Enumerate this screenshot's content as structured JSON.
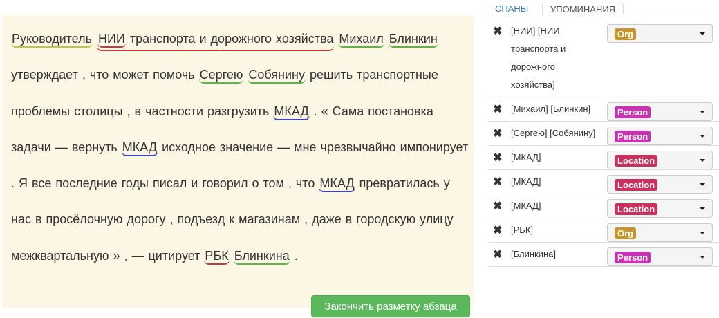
{
  "paragraph": [
    {
      "t": "Руководитель",
      "u": "title"
    },
    " ",
    {
      "u": "org",
      "outer": true,
      "c": [
        {
          "t": "НИИ",
          "u": "org"
        },
        " транспорта и дорожного хозяйства"
      ]
    },
    " ",
    {
      "t": "Михаил",
      "u": "per"
    },
    " ",
    {
      "t": "Блинкин",
      "u": "per"
    },
    " утверждает , что может помочь ",
    {
      "t": "Сергею",
      "u": "per"
    },
    " ",
    {
      "t": "Собянину",
      "u": "per"
    },
    " решить транспортные проблемы столицы , в частности разгрузить ",
    {
      "t": "МКАД",
      "u": "loc"
    },
    " . « Сама постановка задачи — вернуть ",
    {
      "t": "МКАД",
      "u": "loc"
    },
    " исходное значение — мне чрезвычайно импонирует . Я все последние годы писал и говорил о том , что ",
    {
      "t": "МКАД",
      "u": "loc"
    },
    " превратилась у нас в просёлочную дорогу , подъезд к магазинам , даже в городскую улицу межквартальную » , — цитирует ",
    {
      "t": "РБК",
      "u": "org"
    },
    " ",
    {
      "t": "Блинкина",
      "u": "per"
    },
    " ."
  ],
  "finish_button": "Закончить разметку абзаца",
  "tabs": {
    "spans": "СПАНЫ",
    "mentions": "УПОМИНАНИЯ"
  },
  "colors": {
    "Org": "#c8952c",
    "Person": "#c932b2",
    "Location": "#c9305e"
  },
  "mentions": [
    {
      "text": "[НИИ] [НИИ транспорта и дорожного хозяйства]",
      "type": "Org"
    },
    {
      "text": "[Михаил] [Блинкин]",
      "type": "Person"
    },
    {
      "text": "[Сергею] [Собянину]",
      "type": "Person"
    },
    {
      "text": "[МКАД]",
      "type": "Location"
    },
    {
      "text": "[МКАД]",
      "type": "Location"
    },
    {
      "text": "[МКАД]",
      "type": "Location"
    },
    {
      "text": "[РБК]",
      "type": "Org"
    },
    {
      "text": "[Блинкина]",
      "type": "Person"
    }
  ]
}
